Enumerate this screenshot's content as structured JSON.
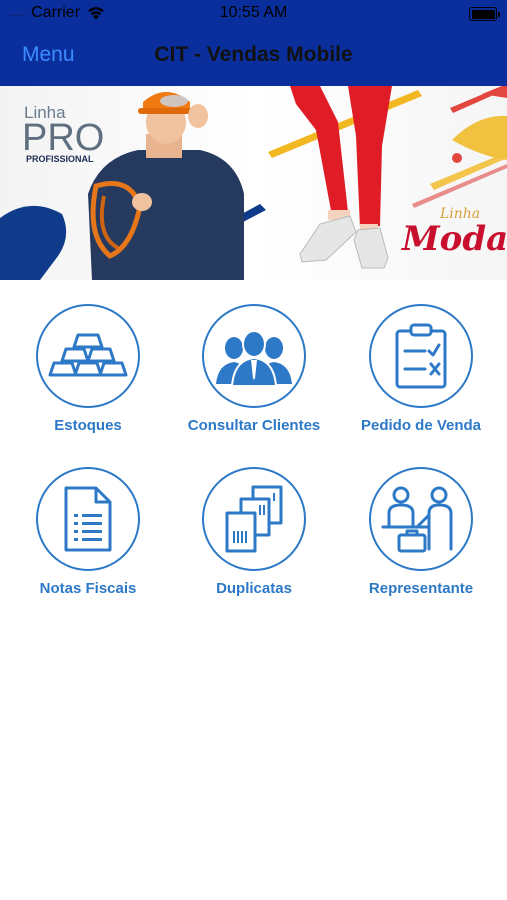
{
  "status_bar": {
    "carrier": "Carrier",
    "time": "10:55 AM",
    "signal_dots": "....",
    "wifi_icon": "wifi-icon",
    "battery_icon": "battery-icon"
  },
  "nav": {
    "menu_label": "Menu",
    "title": "CIT - Vendas Mobile"
  },
  "banner": {
    "linha_label": "Linha",
    "pro_label": "PRO",
    "profissional_label": "PROFISSIONAL",
    "moda_linha_label": "Linha",
    "moda_label": "Moda"
  },
  "tiles": [
    {
      "label": "Estoques",
      "icon": "gold-bars-icon"
    },
    {
      "label": "Consultar Clientes",
      "icon": "people-group-icon"
    },
    {
      "label": "Pedido de Venda",
      "icon": "clipboard-checklist-icon"
    },
    {
      "label": "Notas Fiscais",
      "icon": "document-icon"
    },
    {
      "label": "Duplicatas",
      "icon": "duplicate-documents-icon"
    },
    {
      "label": "Representante",
      "icon": "sales-rep-icon"
    }
  ],
  "colors": {
    "nav_background": "#0a2f9c",
    "menu_link": "#3b8dff",
    "accent": "#2d79c7"
  }
}
